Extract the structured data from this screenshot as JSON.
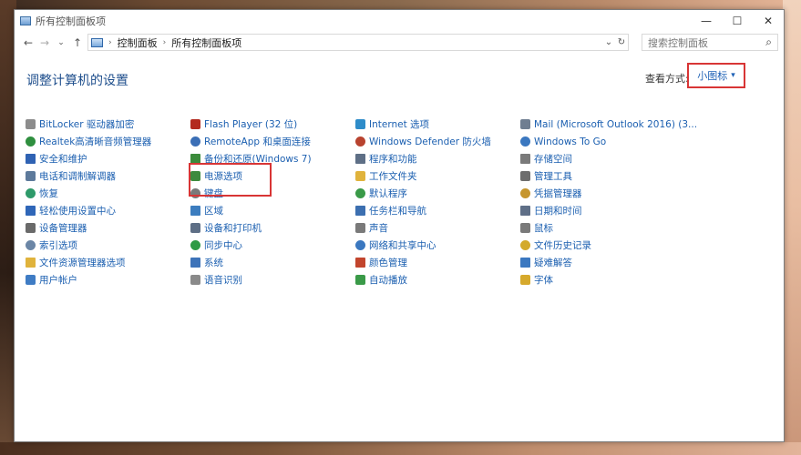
{
  "window": {
    "title": "所有控制面板项",
    "controls": [
      "—",
      "☐",
      "✕"
    ]
  },
  "address": {
    "back": "←",
    "forward": "→",
    "dropdown": "⌄",
    "up": "↑",
    "crumbs": [
      "控制面板",
      "所有控制面板项"
    ],
    "refresh": "↻",
    "dropdown_arrow": "⌄"
  },
  "search": {
    "placeholder": "搜索控制面板",
    "icon": "⌕"
  },
  "main": {
    "title": "调整计算机的设置",
    "view_by_label": "查看方式:",
    "view_by_value": "小图标",
    "view_by_arrow": "▾"
  },
  "columns": [
    {
      "items": [
        {
          "label": "BitLocker 驱动器加密",
          "icon": "bitlocker-icon",
          "color": "#8c8c8c"
        },
        {
          "label": "Realtek高清晰音频管理器",
          "icon": "realtek-icon",
          "color": "#2f8f3f"
        },
        {
          "label": "安全和维护",
          "icon": "flag-icon",
          "color": "#2f62b3"
        },
        {
          "label": "电话和调制解调器",
          "icon": "phone-icon",
          "color": "#5d7a9b"
        },
        {
          "label": "恢复",
          "icon": "recovery-icon",
          "color": "#2e9a6a"
        },
        {
          "label": "轻松使用设置中心",
          "icon": "ease-of-access-icon",
          "color": "#2f66b8"
        },
        {
          "label": "设备管理器",
          "icon": "device-manager-icon",
          "color": "#6a6a6a"
        },
        {
          "label": "索引选项",
          "icon": "indexing-icon",
          "color": "#6b86a6"
        },
        {
          "label": "文件资源管理器选项",
          "icon": "folder-options-icon",
          "color": "#e0b33c"
        },
        {
          "label": "用户帐户",
          "icon": "user-accounts-icon",
          "color": "#3f7cc4"
        }
      ]
    },
    {
      "items": [
        {
          "label": "Flash Player (32 位)",
          "icon": "flash-icon",
          "color": "#b32a1f"
        },
        {
          "label": "RemoteApp 和桌面连接",
          "icon": "remoteapp-icon",
          "color": "#3b6fb6"
        },
        {
          "label": "备份和还原(Windows 7)",
          "icon": "backup-icon",
          "color": "#3c8b3c"
        },
        {
          "label": "电源选项",
          "icon": "power-options-icon",
          "color": "#3d8a3d"
        },
        {
          "label": "键盘",
          "icon": "keyboard-icon",
          "color": "#7a7a7a"
        },
        {
          "label": "区域",
          "icon": "region-icon",
          "color": "#3c7dbf"
        },
        {
          "label": "设备和打印机",
          "icon": "printer-icon",
          "color": "#5e6f86"
        },
        {
          "label": "同步中心",
          "icon": "sync-icon",
          "color": "#2f9a46"
        },
        {
          "label": "系统",
          "icon": "system-icon",
          "color": "#3d73b9"
        },
        {
          "label": "语音识别",
          "icon": "microphone-icon",
          "color": "#8a8a8a"
        }
      ]
    },
    {
      "items": [
        {
          "label": "Internet 选项",
          "icon": "internet-options-icon",
          "color": "#2e8cc9"
        },
        {
          "label": "Windows Defender 防火墙",
          "icon": "firewall-icon",
          "color": "#b8432f"
        },
        {
          "label": "程序和功能",
          "icon": "programs-icon",
          "color": "#5e6f86"
        },
        {
          "label": "工作文件夹",
          "icon": "work-folders-icon",
          "color": "#e0b33c"
        },
        {
          "label": "默认程序",
          "icon": "default-programs-icon",
          "color": "#3a9a48"
        },
        {
          "label": "任务栏和导航",
          "icon": "taskbar-icon",
          "color": "#3c6fb0"
        },
        {
          "label": "声音",
          "icon": "sound-icon",
          "color": "#7a7a7a"
        },
        {
          "label": "网络和共享中心",
          "icon": "network-icon",
          "color": "#3b78c0"
        },
        {
          "label": "颜色管理",
          "icon": "color-management-icon",
          "color": "#c2452d"
        },
        {
          "label": "自动播放",
          "icon": "autoplay-icon",
          "color": "#3a9a48"
        }
      ]
    },
    {
      "items": [
        {
          "label": "Mail (Microsoft Outlook 2016) (3...",
          "icon": "mail-icon",
          "color": "#6f7e91"
        },
        {
          "label": "Windows To Go",
          "icon": "windows-to-go-icon",
          "color": "#3b78c0"
        },
        {
          "label": "存储空间",
          "icon": "storage-spaces-icon",
          "color": "#7a7a7a"
        },
        {
          "label": "管理工具",
          "icon": "admin-tools-icon",
          "color": "#6e6e6e"
        },
        {
          "label": "凭据管理器",
          "icon": "credential-manager-icon",
          "color": "#c6962e"
        },
        {
          "label": "日期和时间",
          "icon": "date-time-icon",
          "color": "#5f6f87"
        },
        {
          "label": "鼠标",
          "icon": "mouse-icon",
          "color": "#7a7a7a"
        },
        {
          "label": "文件历史记录",
          "icon": "file-history-icon",
          "color": "#d3aa2c"
        },
        {
          "label": "疑难解答",
          "icon": "troubleshooting-icon",
          "color": "#3b78c0"
        },
        {
          "label": "字体",
          "icon": "fonts-icon",
          "color": "#d6a92c"
        }
      ]
    }
  ]
}
